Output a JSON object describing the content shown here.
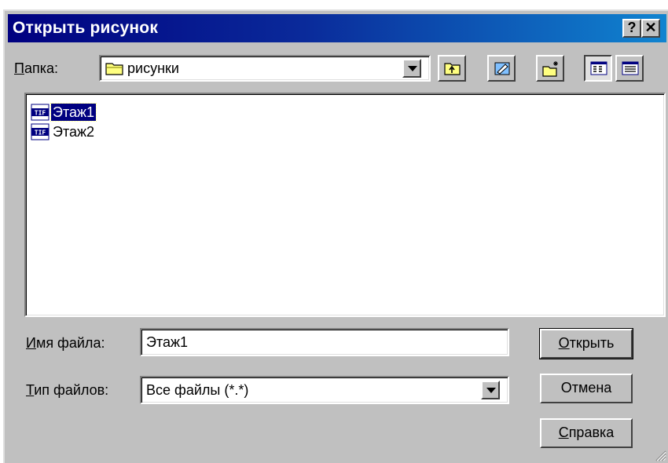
{
  "window": {
    "title": "Открыть рисунок",
    "help_label": "?",
    "close_label": "✕"
  },
  "folder": {
    "label_u": "П",
    "label_rest": "апка:",
    "value": "рисунки"
  },
  "toolbar": {
    "icons": [
      "up-one-level-icon",
      "desktop-icon",
      "new-folder-icon",
      "list-view-icon",
      "details-view-icon"
    ]
  },
  "files": [
    {
      "name": "Этаж1",
      "type": "TIF",
      "selected": true
    },
    {
      "name": "Этаж2",
      "type": "TIF",
      "selected": false
    }
  ],
  "filename": {
    "label_u": "И",
    "label_rest": "мя файла:",
    "value": "Этаж1"
  },
  "filetype": {
    "label_u": "Т",
    "label_rest": "ип файлов:",
    "value": "Все файлы (*.*)"
  },
  "buttons": {
    "open_u": "О",
    "open_rest": "ткрыть",
    "cancel": "Отмена",
    "help_u": "С",
    "help_rest": "правка"
  },
  "colors": {
    "titlebar_start": "#000080",
    "titlebar_end": "#1084d0",
    "selection": "#000080",
    "face": "#c0c0c0"
  }
}
